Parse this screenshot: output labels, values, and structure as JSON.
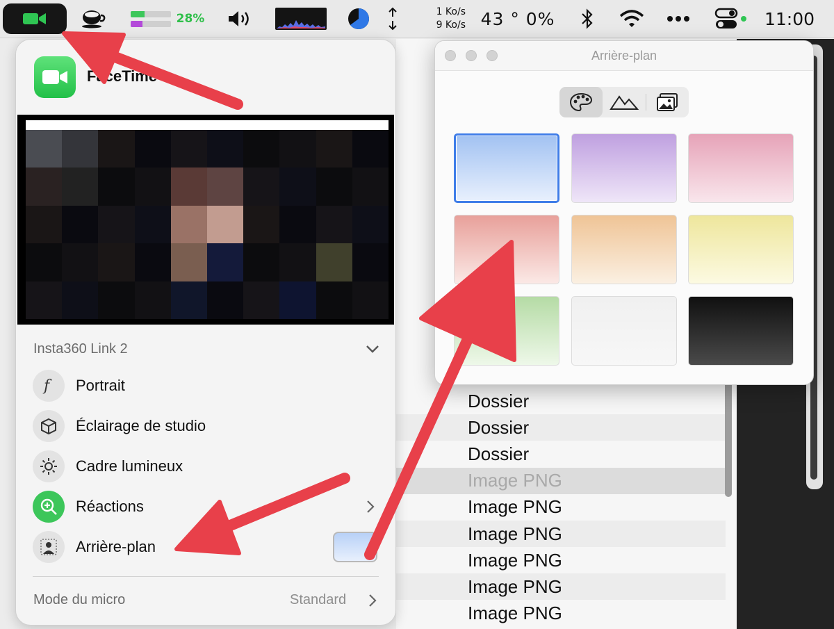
{
  "menubar": {
    "battery_percent": "28%",
    "battery_bars": [
      {
        "color": "#3cc75a",
        "level": 0.35
      },
      {
        "color": "#b34ad9",
        "level": 0.3
      }
    ],
    "net_up": "1 Ko/s",
    "net_down": "9 Ko/s",
    "temp_cpu": "43 °  0%",
    "clock": "11:00",
    "icons": [
      "video-camera-icon",
      "coffee-cup-icon",
      "speaker-icon",
      "activity-graph-icon",
      "pie-disk-icon",
      "up-down-arrows-icon",
      "bluetooth-icon",
      "wifi-icon",
      "more-dots-icon",
      "control-center-icon"
    ]
  },
  "facetime_panel": {
    "app_name": "FaceTime",
    "device": "Insta360 Link 2",
    "effects": [
      {
        "label": "Portrait",
        "icon": "f-stop-icon"
      },
      {
        "label": "Éclairage de studio",
        "icon": "cube-icon"
      },
      {
        "label": "Cadre lumineux",
        "icon": "sun-icon"
      },
      {
        "label": "Réactions",
        "icon": "reactions-plus-icon"
      },
      {
        "label": "Arrière-plan",
        "icon": "person-background-icon"
      }
    ],
    "mic_mode_label": "Mode du micro",
    "mic_mode_value": "Standard",
    "selected_background_color": "#b8d1f7"
  },
  "background_window": {
    "title": "Arrière-plan",
    "tabs": [
      "palette-icon",
      "mountains-icon",
      "photo-icon"
    ],
    "active_tab": 0,
    "swatches": [
      {
        "top": "#a2c2f2",
        "bottom": "#e8f0fd",
        "selected": true
      },
      {
        "top": "#bfa0e0",
        "bottom": "#efe6f8",
        "selected": false
      },
      {
        "top": "#e6a3b8",
        "bottom": "#f9e6ec",
        "selected": false
      },
      {
        "top": "#e8a09a",
        "bottom": "#fbe9e6",
        "selected": false
      },
      {
        "top": "#efc496",
        "bottom": "#fbf0e2",
        "selected": false
      },
      {
        "top": "#eee69c",
        "bottom": "#fcfae2",
        "selected": false
      },
      {
        "top": "#b5dba5",
        "bottom": "#eef8e9",
        "selected": false
      },
      {
        "top": "#f0f0f0",
        "bottom": "#f7f7f7",
        "selected": false
      },
      {
        "top": "#101010",
        "bottom": "#4a4a4a",
        "selected": false
      }
    ]
  },
  "finder": {
    "rows": [
      {
        "name": "Dossier",
        "dim": false
      },
      {
        "name": "Dossier",
        "dim": false
      },
      {
        "name": "Dossier",
        "dim": false
      },
      {
        "name": "Image PNG",
        "dim": true
      },
      {
        "name": "Image PNG",
        "dim": false
      },
      {
        "name": "Image PNG",
        "dim": false
      },
      {
        "name": "Image PNG",
        "dim": false
      },
      {
        "name": "Image PNG",
        "dim": false
      },
      {
        "name": "Image PNG",
        "dim": false
      }
    ]
  },
  "colors": {
    "annotation_arrow": "#e8404a",
    "selection_blue": "#3f7de8",
    "facetime_green": "#2fc553"
  }
}
